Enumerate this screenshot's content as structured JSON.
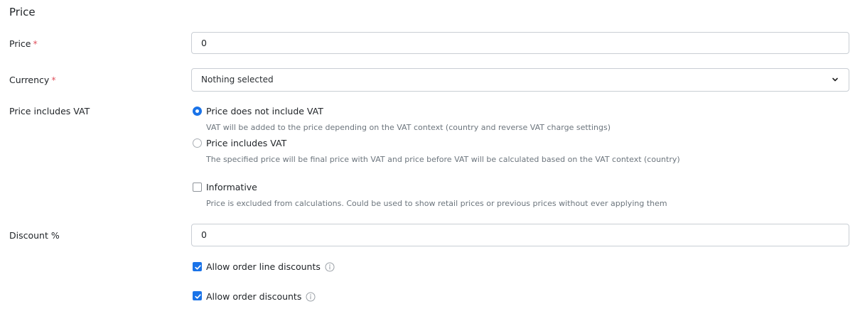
{
  "section": {
    "title": "Price"
  },
  "price": {
    "label": "Price",
    "required_mark": "*",
    "value": "0"
  },
  "currency": {
    "label": "Currency",
    "required_mark": "*",
    "selected": "Nothing selected"
  },
  "vat": {
    "label": "Price includes VAT",
    "options": [
      {
        "label": "Price does not include VAT",
        "help": "VAT will be added to the price depending on the VAT context (country and reverse VAT charge settings)",
        "selected": true
      },
      {
        "label": "Price includes VAT",
        "help": "The specified price will be final price with VAT and price before VAT will be calculated based on the VAT context (country)",
        "selected": false
      }
    ]
  },
  "informative": {
    "label": "Informative",
    "help": "Price is excluded from calculations. Could be used to show retail prices or previous prices without ever applying them",
    "checked": false
  },
  "discount": {
    "label": "Discount %",
    "value": "0"
  },
  "allow_line_discounts": {
    "label": "Allow order line discounts",
    "checked": true,
    "icon": "info-icon"
  },
  "allow_order_discounts": {
    "label": "Allow order discounts",
    "checked": true,
    "icon": "info-icon"
  },
  "colors": {
    "accent": "#1a73e8",
    "required": "#e0525e",
    "help_text": "#6c757d",
    "border": "#c9ced4"
  }
}
